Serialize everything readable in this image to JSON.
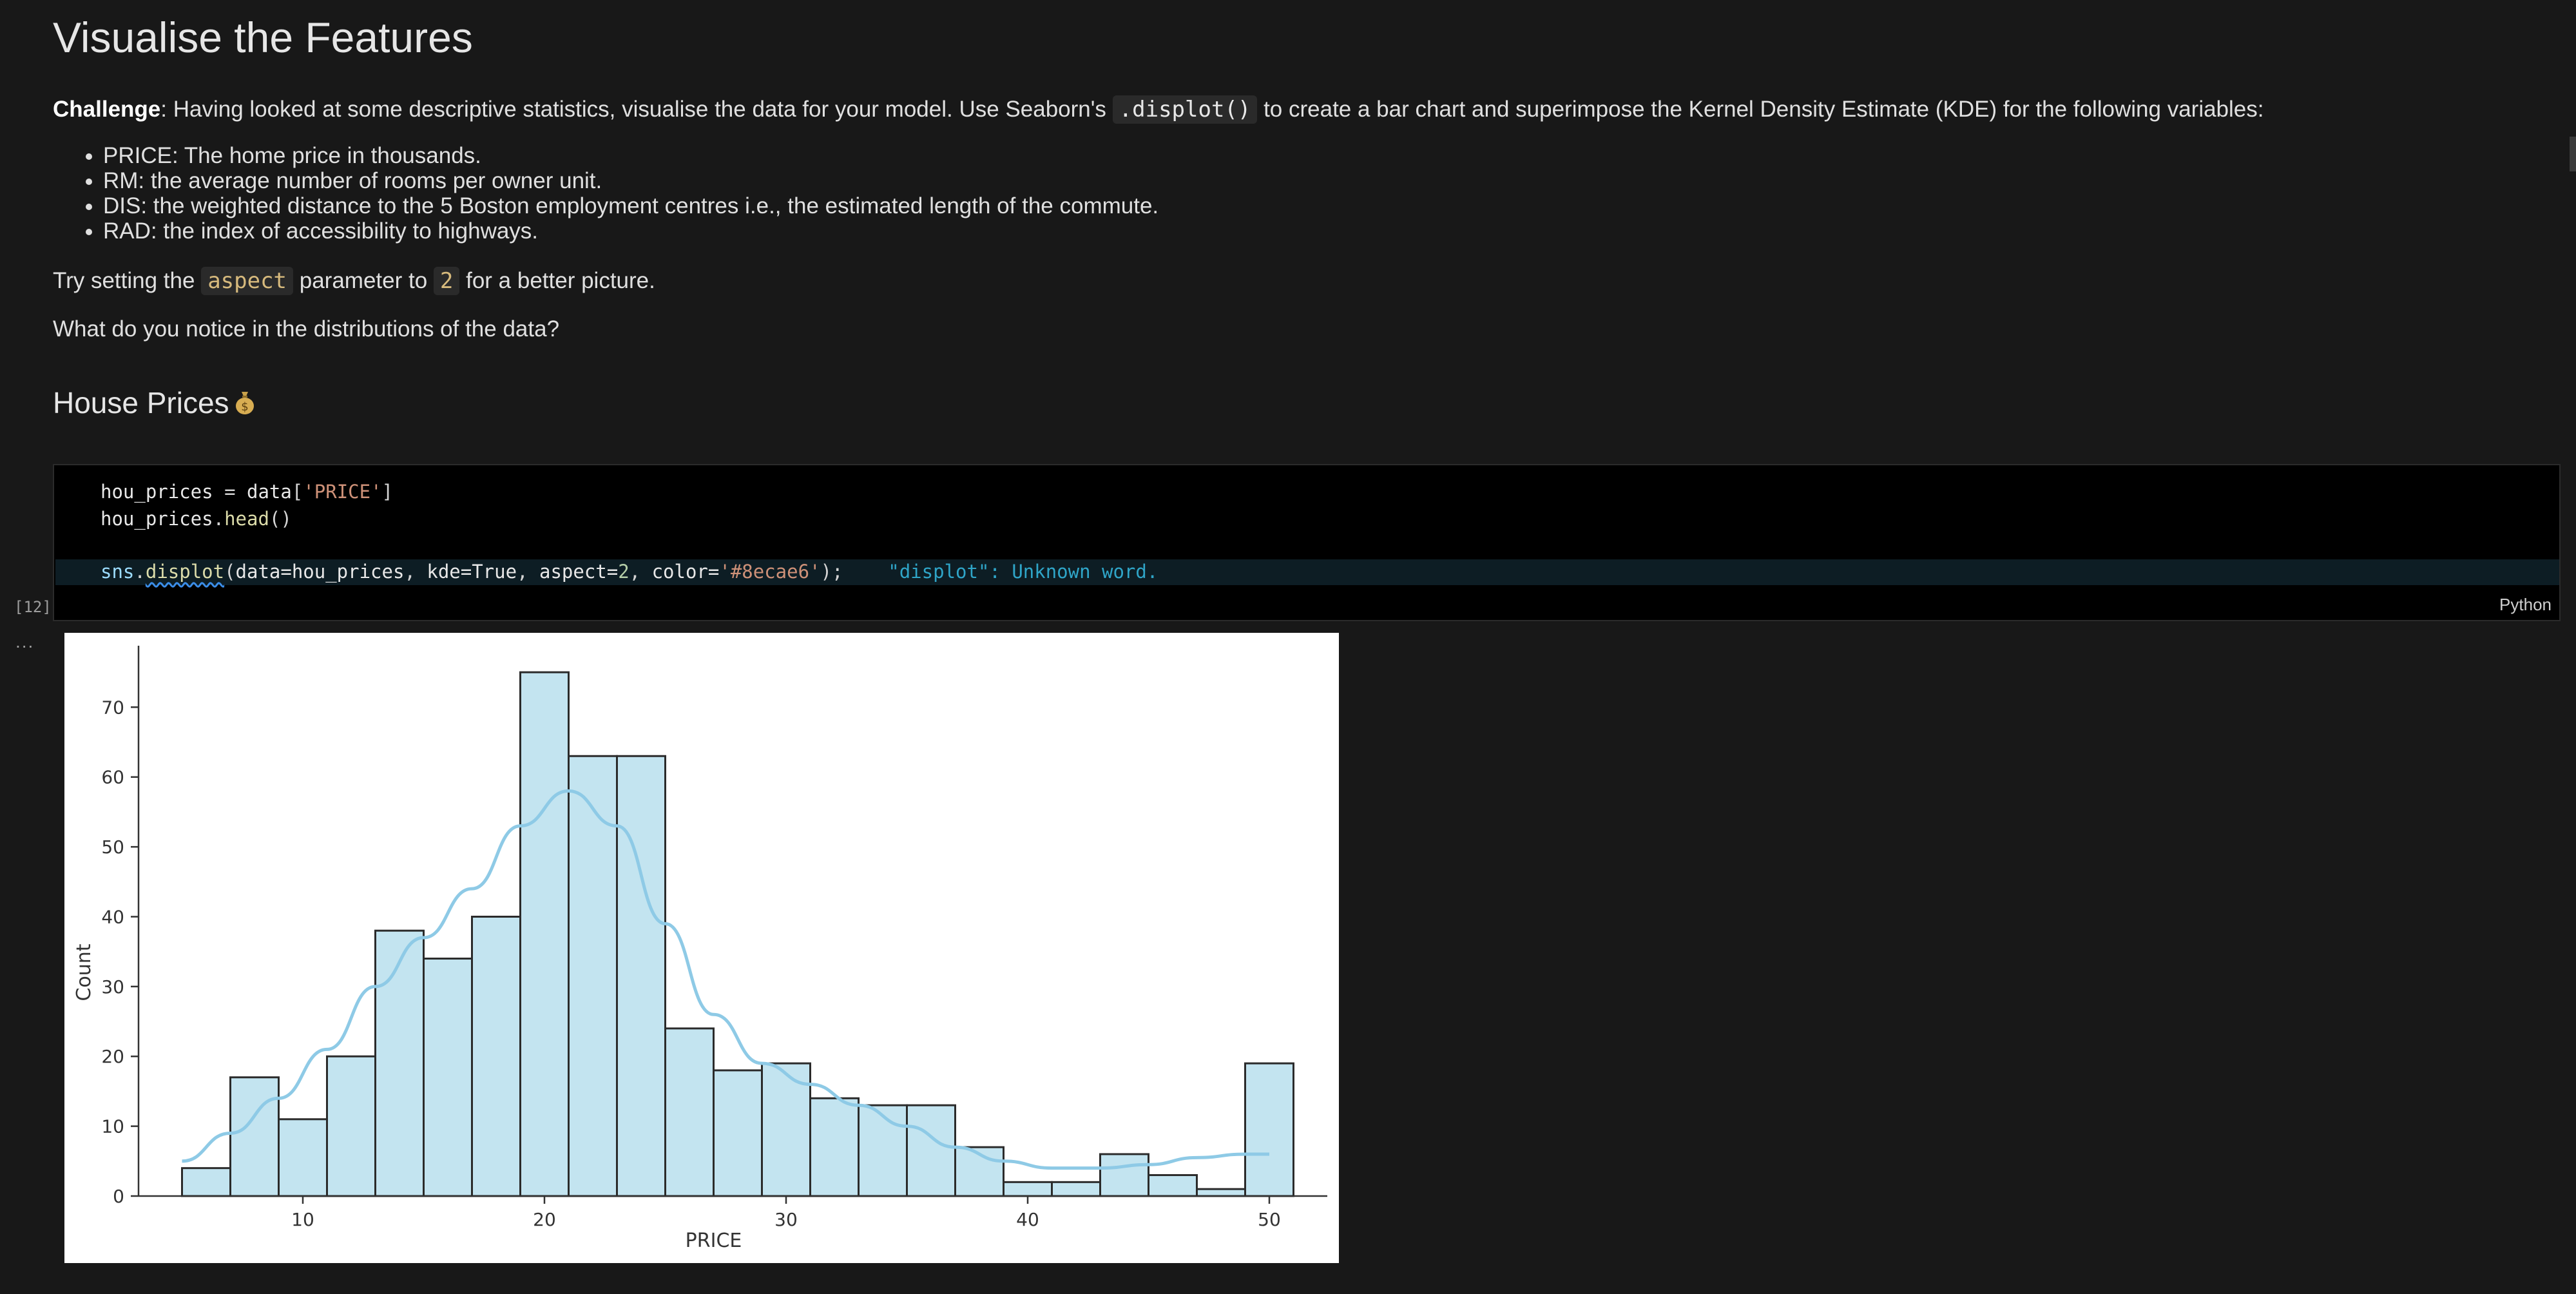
{
  "heading": "Visualise the Features",
  "challenge": {
    "label": "Challenge",
    "text_before": ": Having looked at some descriptive statistics, visualise the data for your model. Use Seaborn's ",
    "code": ".displot()",
    "text_after": " to create a bar chart and superimpose the Kernel Density Estimate (KDE) for the following variables:"
  },
  "variables": [
    "PRICE: The home price in thousands.",
    "RM: the average number of rooms per owner unit.",
    "DIS: the weighted distance to the 5 Boston employment centres i.e., the estimated length of the commute.",
    "RAD: the index of accessibility to highways."
  ],
  "tip": {
    "before": "Try setting the ",
    "param": "aspect",
    "middle": " parameter to ",
    "value": "2",
    "after": " for a better picture."
  },
  "question": "What do you notice in the distributions of the data?",
  "section_title": "House Prices",
  "section_icon": "money-bag-icon",
  "cell": {
    "execution_count": "[12]",
    "language": "Python",
    "output_prefix": "...",
    "line1": {
      "var": "hou_prices",
      "op": " = ",
      "obj": "data",
      "open": "[",
      "key": "'PRICE'",
      "close": "]"
    },
    "line2": {
      "var": "hou_prices",
      "dot": ".",
      "method": "head",
      "parens": "()"
    },
    "line3": {
      "mod": "sns",
      "dot": ".",
      "func": "displot",
      "open": "(",
      "a1": "data=hou_prices",
      "sep1": ", ",
      "a2": "kde=True",
      "sep2": ", ",
      "a3k": "aspect=",
      "a3v": "2",
      "sep3": ", ",
      "a4k": "color=",
      "a4v": "'#8ecae6'",
      "close": ");"
    },
    "diagnostic": "\"displot\": Unknown word."
  },
  "colors": {
    "bar": "#c3e4f0",
    "kde": "#8ecae6",
    "edge": "#2b2b2b"
  },
  "chart_data": {
    "type": "bar",
    "bins": [
      [
        5.0,
        7.0
      ],
      [
        7.0,
        9.0
      ],
      [
        9.0,
        11.0
      ],
      [
        11.0,
        13.0
      ],
      [
        13.0,
        15.0
      ],
      [
        15.0,
        17.0
      ],
      [
        17.0,
        19.0
      ],
      [
        19.0,
        21.0
      ],
      [
        21.0,
        23.0
      ],
      [
        23.0,
        25.0
      ],
      [
        25.0,
        27.0
      ],
      [
        27.0,
        29.0
      ],
      [
        29.0,
        31.0
      ],
      [
        31.0,
        33.0
      ],
      [
        33.0,
        35.0
      ],
      [
        35.0,
        37.0
      ],
      [
        37.0,
        39.0
      ],
      [
        39.0,
        41.0
      ],
      [
        41.0,
        43.0
      ],
      [
        43.0,
        45.0
      ],
      [
        45.0,
        47.0
      ],
      [
        47.0,
        49.0
      ],
      [
        49.0,
        51.0
      ]
    ],
    "values": [
      4,
      17,
      11,
      20,
      38,
      34,
      40,
      75,
      63,
      63,
      24,
      18,
      19,
      14,
      13,
      13,
      7,
      2,
      2,
      6,
      3,
      1,
      19
    ],
    "kde": {
      "x": [
        5,
        7,
        9,
        11,
        13,
        15,
        17,
        19,
        21,
        23,
        25,
        27,
        29,
        31,
        33,
        35,
        37,
        39,
        41,
        43,
        45,
        47,
        49,
        50
      ],
      "y": [
        5,
        9,
        14,
        21,
        30,
        37,
        44,
        53,
        58,
        53,
        39,
        26,
        19,
        16,
        13,
        10,
        7,
        5,
        4,
        4,
        4.5,
        5.5,
        6,
        6
      ]
    },
    "xlabel": "PRICE",
    "ylabel": "Count",
    "xticks": [
      10,
      20,
      30,
      40,
      50
    ],
    "yticks": [
      0,
      10,
      20,
      30,
      40,
      50,
      60,
      70
    ],
    "xlim": [
      3.2,
      52.4
    ],
    "ylim": [
      0,
      78.8
    ],
    "kde_on": true,
    "grid": false
  }
}
